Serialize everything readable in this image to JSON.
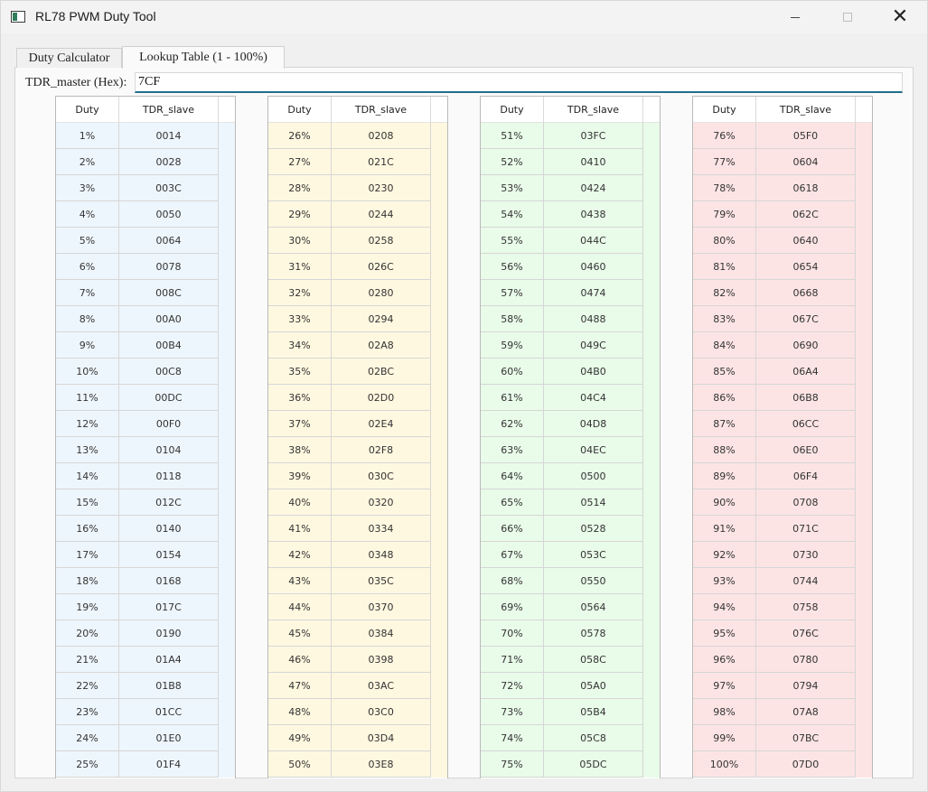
{
  "window": {
    "title": "RL78 PWM Duty Tool",
    "controls": {
      "minimize": "minimize-icon",
      "maximize": "maximize-icon",
      "close": "close-icon"
    }
  },
  "tabs": [
    {
      "label": "Duty Calculator",
      "selected": false
    },
    {
      "label": "Lookup Table (1 - 100%)",
      "selected": true
    }
  ],
  "tdr_master": {
    "label": "TDR_master (Hex):",
    "value": "7CF"
  },
  "tables": [
    {
      "color": "#eef6fd",
      "headers": [
        "Duty",
        "TDR_slave"
      ],
      "rows": [
        [
          "1%",
          "0014"
        ],
        [
          "2%",
          "0028"
        ],
        [
          "3%",
          "003C"
        ],
        [
          "4%",
          "0050"
        ],
        [
          "5%",
          "0064"
        ],
        [
          "6%",
          "0078"
        ],
        [
          "7%",
          "008C"
        ],
        [
          "8%",
          "00A0"
        ],
        [
          "9%",
          "00B4"
        ],
        [
          "10%",
          "00C8"
        ],
        [
          "11%",
          "00DC"
        ],
        [
          "12%",
          "00F0"
        ],
        [
          "13%",
          "0104"
        ],
        [
          "14%",
          "0118"
        ],
        [
          "15%",
          "012C"
        ],
        [
          "16%",
          "0140"
        ],
        [
          "17%",
          "0154"
        ],
        [
          "18%",
          "0168"
        ],
        [
          "19%",
          "017C"
        ],
        [
          "20%",
          "0190"
        ],
        [
          "21%",
          "01A4"
        ],
        [
          "22%",
          "01B8"
        ],
        [
          "23%",
          "01CC"
        ],
        [
          "24%",
          "01E0"
        ],
        [
          "25%",
          "01F4"
        ]
      ]
    },
    {
      "color": "#fff8e0",
      "headers": [
        "Duty",
        "TDR_slave"
      ],
      "rows": [
        [
          "26%",
          "0208"
        ],
        [
          "27%",
          "021C"
        ],
        [
          "28%",
          "0230"
        ],
        [
          "29%",
          "0244"
        ],
        [
          "30%",
          "0258"
        ],
        [
          "31%",
          "026C"
        ],
        [
          "32%",
          "0280"
        ],
        [
          "33%",
          "0294"
        ],
        [
          "34%",
          "02A8"
        ],
        [
          "35%",
          "02BC"
        ],
        [
          "36%",
          "02D0"
        ],
        [
          "37%",
          "02E4"
        ],
        [
          "38%",
          "02F8"
        ],
        [
          "39%",
          "030C"
        ],
        [
          "40%",
          "0320"
        ],
        [
          "41%",
          "0334"
        ],
        [
          "42%",
          "0348"
        ],
        [
          "43%",
          "035C"
        ],
        [
          "44%",
          "0370"
        ],
        [
          "45%",
          "0384"
        ],
        [
          "46%",
          "0398"
        ],
        [
          "47%",
          "03AC"
        ],
        [
          "48%",
          "03C0"
        ],
        [
          "49%",
          "03D4"
        ],
        [
          "50%",
          "03E8"
        ]
      ]
    },
    {
      "color": "#e9fbe9",
      "headers": [
        "Duty",
        "TDR_slave"
      ],
      "rows": [
        [
          "51%",
          "03FC"
        ],
        [
          "52%",
          "0410"
        ],
        [
          "53%",
          "0424"
        ],
        [
          "54%",
          "0438"
        ],
        [
          "55%",
          "044C"
        ],
        [
          "56%",
          "0460"
        ],
        [
          "57%",
          "0474"
        ],
        [
          "58%",
          "0488"
        ],
        [
          "59%",
          "049C"
        ],
        [
          "60%",
          "04B0"
        ],
        [
          "61%",
          "04C4"
        ],
        [
          "62%",
          "04D8"
        ],
        [
          "63%",
          "04EC"
        ],
        [
          "64%",
          "0500"
        ],
        [
          "65%",
          "0514"
        ],
        [
          "66%",
          "0528"
        ],
        [
          "67%",
          "053C"
        ],
        [
          "68%",
          "0550"
        ],
        [
          "69%",
          "0564"
        ],
        [
          "70%",
          "0578"
        ],
        [
          "71%",
          "058C"
        ],
        [
          "72%",
          "05A0"
        ],
        [
          "73%",
          "05B4"
        ],
        [
          "74%",
          "05C8"
        ],
        [
          "75%",
          "05DC"
        ]
      ]
    },
    {
      "color": "#fde4e4",
      "headers": [
        "Duty",
        "TDR_slave"
      ],
      "rows": [
        [
          "76%",
          "05F0"
        ],
        [
          "77%",
          "0604"
        ],
        [
          "78%",
          "0618"
        ],
        [
          "79%",
          "062C"
        ],
        [
          "80%",
          "0640"
        ],
        [
          "81%",
          "0654"
        ],
        [
          "82%",
          "0668"
        ],
        [
          "83%",
          "067C"
        ],
        [
          "84%",
          "0690"
        ],
        [
          "85%",
          "06A4"
        ],
        [
          "86%",
          "06B8"
        ],
        [
          "87%",
          "06CC"
        ],
        [
          "88%",
          "06E0"
        ],
        [
          "89%",
          "06F4"
        ],
        [
          "90%",
          "0708"
        ],
        [
          "91%",
          "071C"
        ],
        [
          "92%",
          "0730"
        ],
        [
          "93%",
          "0744"
        ],
        [
          "94%",
          "0758"
        ],
        [
          "95%",
          "076C"
        ],
        [
          "96%",
          "0780"
        ],
        [
          "97%",
          "0794"
        ],
        [
          "98%",
          "07A8"
        ],
        [
          "99%",
          "07BC"
        ],
        [
          "100%",
          "07D0"
        ]
      ]
    }
  ]
}
